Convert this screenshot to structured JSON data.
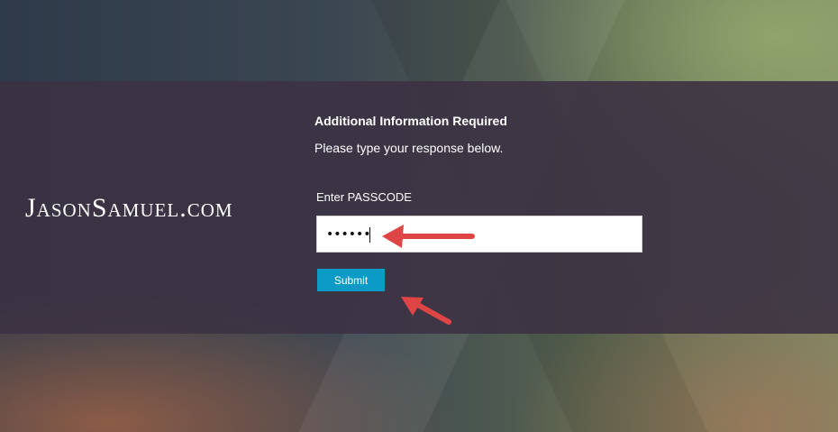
{
  "brand": {
    "logo_text": "JasonSamuel.com"
  },
  "form": {
    "title": "Additional Information Required",
    "instruction": "Please type your response below.",
    "passcode_label": "Enter PASSCODE",
    "passcode_value": "••••••",
    "submit_label": "Submit"
  },
  "annotations": {
    "arrow_color": "#e04545",
    "arrows": [
      "arrow-to-passcode",
      "arrow-to-submit"
    ]
  },
  "colors": {
    "band": "#3c3242",
    "button": "#0b9bc6"
  }
}
